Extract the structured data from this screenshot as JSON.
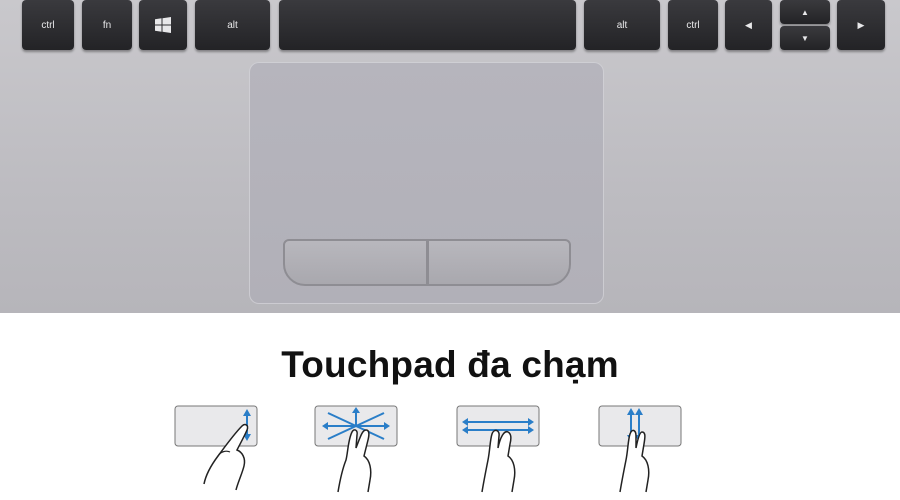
{
  "keyboard": {
    "keys": {
      "ctrl_left": "ctrl",
      "fn": "fn",
      "windows": "",
      "alt_left": "alt",
      "space": "",
      "alt_right": "alt",
      "ctrl_right": "ctrl"
    },
    "arrow_glyphs": {
      "left": "◀",
      "up": "▲",
      "down": "▼",
      "right": "▶"
    }
  },
  "title": "Touchpad đa chạm",
  "colors": {
    "key": "#2a2a2e",
    "key_text": "#e8e8ea",
    "touchpad": "#b4b3ba",
    "gesture_arrow": "#2a7ec8",
    "title": "#111111"
  },
  "gestures": [
    {
      "icon": "one-finger-vertical-scroll-icon"
    },
    {
      "icon": "two-finger-pinch-zoom-icon"
    },
    {
      "icon": "two-finger-horizontal-swipe-icon"
    },
    {
      "icon": "two-finger-vertical-scroll-icon"
    }
  ]
}
